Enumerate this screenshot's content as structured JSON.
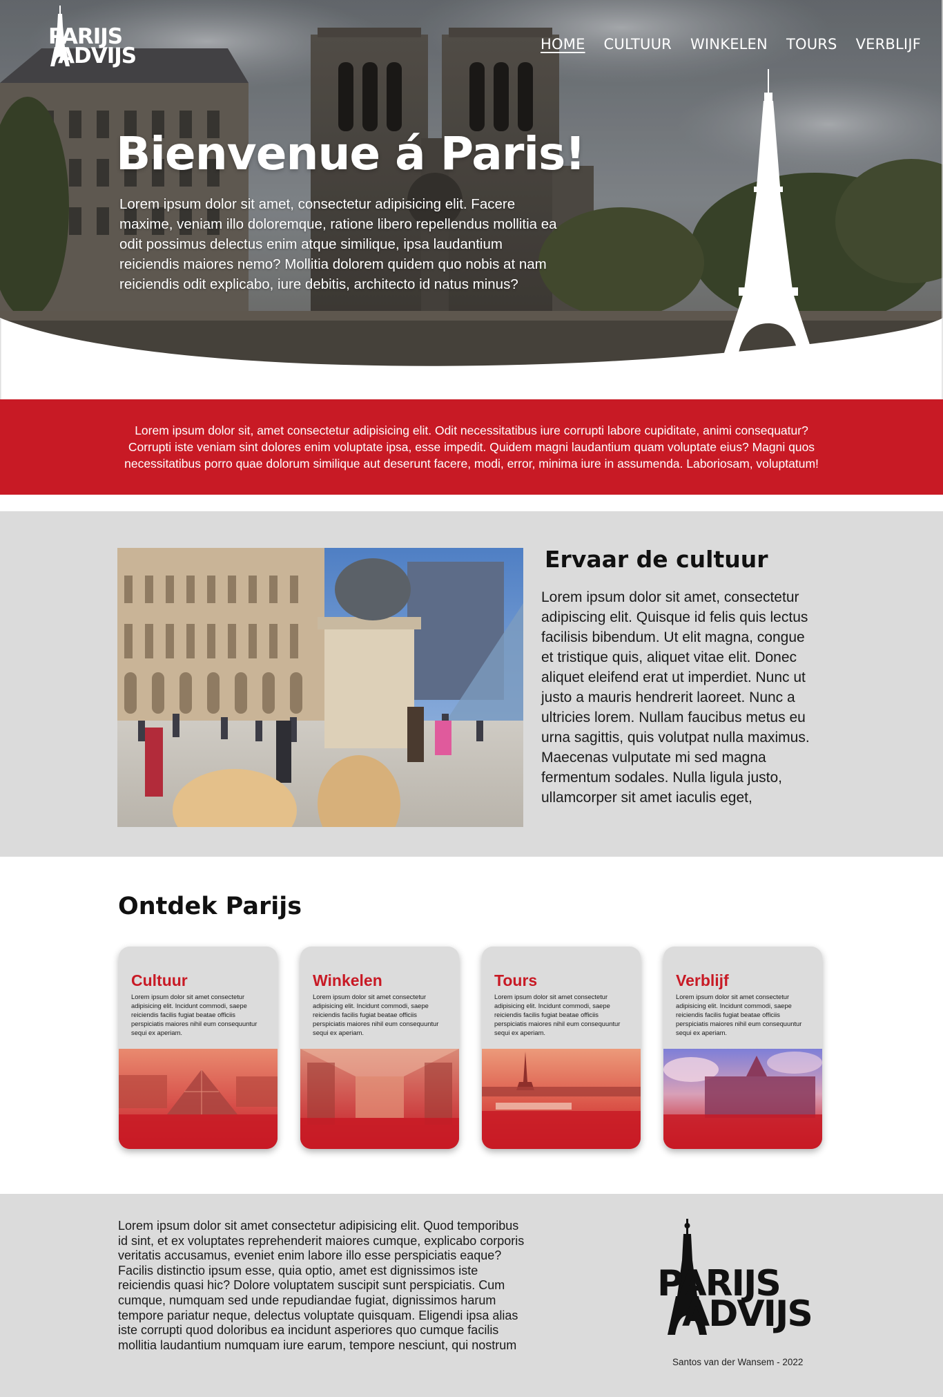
{
  "logo": {
    "line1": "PARIJS",
    "line2": "ADVIJS"
  },
  "nav": [
    {
      "label": "HOME"
    },
    {
      "label": "CULTUUR"
    },
    {
      "label": "WINKELEN"
    },
    {
      "label": "TOURS"
    },
    {
      "label": "VERBLIJF"
    }
  ],
  "hero": {
    "title": "Bienvenue á Paris!",
    "text": "Lorem ipsum dolor sit amet, consectetur adipisicing elit. Facere maxime, veniam illo doloremque, ratione libero repellendus mollitia ea odit possimus delectus enim atque similique, ipsa laudantium reiciendis maiores nemo? Mollitia dolorem quidem quo nobis at nam reiciendis odit explicabo, iure debitis, architecto id natus minus?"
  },
  "band": {
    "text": "Lorem ipsum dolor sit, amet consectetur adipisicing elit. Odit necessitatibus iure corrupti labore cupiditate, animi consequatur? Corrupti iste veniam sint dolores enim voluptate ipsa, esse impedit. Quidem magni laudantium quam voluptate eius? Magni quos necessitatibus porro quae dolorum similique aut deserunt facere, modi, error, minima iure in assumenda. Laboriosam, voluptatum!"
  },
  "culture": {
    "title": "Ervaar de cultuur",
    "text": "Lorem ipsum dolor sit amet, consectetur adipiscing elit. Quisque id felis quis lectus facilisis bibendum. Ut elit magna, congue et tristique quis, aliquet vitae elit. Donec aliquet eleifend erat ut imperdiet. Nunc ut justo a mauris hendrerit laoreet. Nunc a ultricies lorem. Nullam faucibus metus eu urna sagittis, quis volutpat nulla maximus. Maecenas vulputate mi sed magna fermentum sodales. Nulla ligula justo, ullamcorper sit amet iaculis eget,"
  },
  "discover": {
    "title": "Ontdek Parijs",
    "cards": [
      {
        "title": "Cultuur",
        "text": "Lorem ipsum dolor sit amet consectetur adipisicing elit. Incidunt commodi, saepe reiciendis facilis fugiat beatae officiis perspiciatis maiores nihil eum consequuntur sequi ex aperiam."
      },
      {
        "title": "Winkelen",
        "text": "Lorem ipsum dolor sit amet consectetur adipisicing elit. Incidunt commodi, saepe reiciendis facilis fugiat beatae officiis perspiciatis maiores nihil eum consequuntur sequi ex aperiam."
      },
      {
        "title": "Tours",
        "text": "Lorem ipsum dolor sit amet consectetur adipisicing elit. Incidunt commodi, saepe reiciendis facilis fugiat beatae officiis perspiciatis maiores nihil eum consequuntur sequi ex aperiam."
      },
      {
        "title": "Verblijf",
        "text": "Lorem ipsum dolor sit amet consectetur adipisicing elit. Incidunt commodi, saepe reiciendis facilis fugiat beatae officiis perspiciatis maiores nihil eum consequuntur sequi ex aperiam."
      }
    ]
  },
  "footer": {
    "text": "Lorem ipsum dolor sit amet consectetur adipisicing elit. Quod temporibus id sint, et ex voluptates reprehenderit maiores cumque, explicabo corporis veritatis accusamus, eveniet enim labore illo esse perspiciatis eaque? Facilis distinctio ipsum esse, quia optio, amet est dignissimos iste reiciendis quasi hic? Dolore voluptatem suscipit sunt perspiciatis. Cum cumque, numquam sed unde repudiandae fugiat, dignissimos harum tempore pariatur neque, delectus voluptate quisquam. Eligendi ipsa alias iste corrupti quod doloribus ea incidunt asperiores quo cumque facilis mollitia laudantium numquam iure earum, tempore nesciunt, qui nostrum",
    "logo_line1": "PARIJS",
    "logo_line2": "ADVIJS",
    "credit": "Santos van der Wansem - 2022"
  },
  "colors": {
    "brand_red": "#c81a25",
    "section_grey": "#dbdbdb",
    "white": "#ffffff"
  }
}
